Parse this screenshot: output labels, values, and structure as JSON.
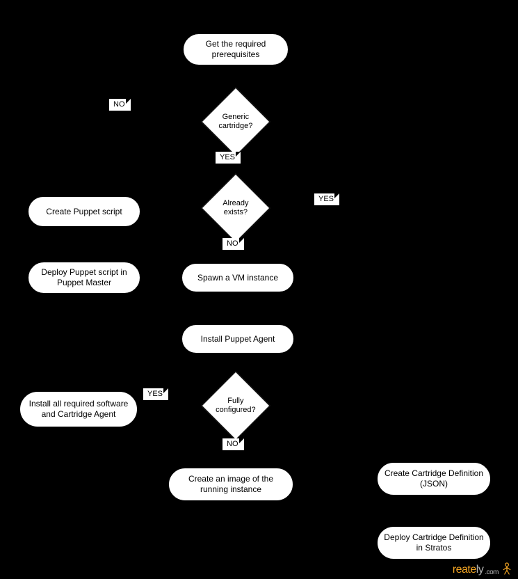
{
  "nodes": {
    "get_prereq": "Get the required prerequisites",
    "generic_cartridge": "Generic cartridge?",
    "already_exists": "Already exists?",
    "create_puppet_script": "Create Puppet script",
    "deploy_puppet_master": "Deploy Puppet script in Puppet Master",
    "spawn_vm": "Spawn a VM instance",
    "install_puppet_agent": "Install Puppet Agent",
    "fully_configured": "Fully configured?",
    "install_all_req": "Install all required software and Cartridge Agent",
    "create_image": "Create an image of the running instance",
    "create_cart_def": "Create Cartridge Definition (JSON)",
    "deploy_cart_def": "Deploy Cartridge Definition in Stratos"
  },
  "labels": {
    "no": "NO",
    "yes": "YES"
  },
  "watermark": {
    "text_left": "reate",
    "text_right": "ly",
    "domain": ".com"
  }
}
